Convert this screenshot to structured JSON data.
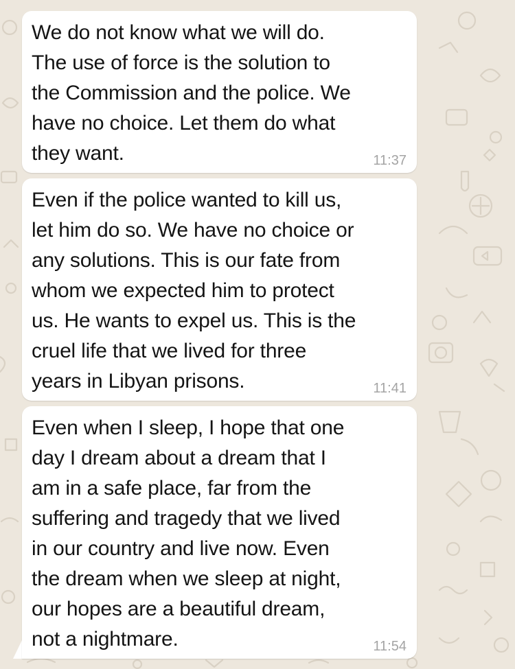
{
  "theme": {
    "background": "#ede7dd",
    "bubble_color": "#ffffff",
    "text_color": "#141414",
    "time_color": "#a4a4a4"
  },
  "messages": [
    {
      "text": "We do not know what we will do.\nThe use of force is the solution to\nthe Commission and the police. We\nhave no choice. Let them do what\nthey want.",
      "time": "11:37"
    },
    {
      "text": "Even if the police wanted to kill us,\nlet him do so. We have no choice or\nany solutions. This is our fate from\nwhom we expected him to protect\nus. He wants to expel us. This is the\ncruel life that we lived for three\nyears in Libyan prisons.",
      "time": "11:41"
    },
    {
      "text": "Even when I sleep, I hope that one\nday I dream about a dream that I\nam in a safe place, far from the\nsuffering and tragedy that we lived\nin our country and live now. Even\nthe dream when we sleep at night,\nour hopes are a beautiful dream,\nnot a nightmare.",
      "time": "11:54"
    }
  ]
}
